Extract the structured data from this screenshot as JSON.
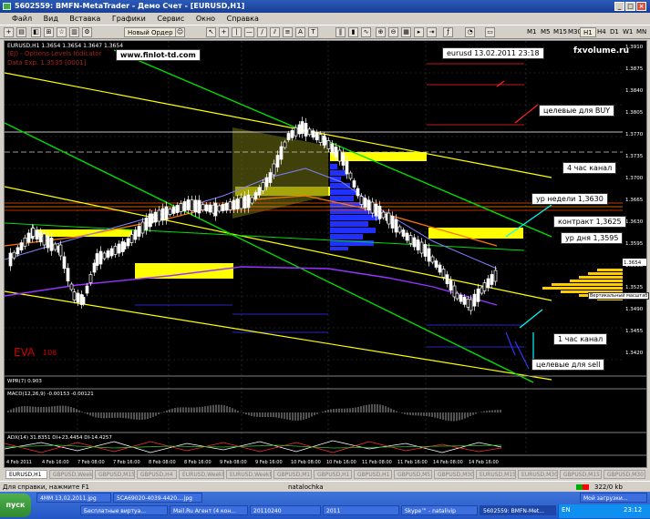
{
  "title": "5602559: BMFN-MetaTrader - Демо Счет - [EURUSD,H1]",
  "menu": [
    "Файл",
    "Вид",
    "Вставка",
    "Графики",
    "Сервис",
    "Окно",
    "Справка"
  ],
  "toolbar": {
    "new_order": "Новый Ордер",
    "timeframes": [
      "M1",
      "M5",
      "M15",
      "M30",
      "H1",
      "H4",
      "D1",
      "W1",
      "MN"
    ]
  },
  "chart": {
    "symbol_info": "EURUSD,H1  1.3654 1.3654 1.3647 1.3654",
    "indicator_line1": "(EJ) - Options Levels Indicator",
    "indicator_line2": "Data Exp. 1.3535 [0001]",
    "ema_label": "EVA",
    "ema_value": "106",
    "macd_label": "MACD(12,26,9) -0.00153 -0.00121",
    "adx_label": "ADX(14) 31.8351 DI+23.4454 DI-14.4257",
    "wpr_label": "WPR(7) 0.903",
    "price_ticks": [
      "1.3910",
      "1.3875",
      "1.3840",
      "1.3805",
      "1.3770",
      "1.3735",
      "1.3700",
      "1.3665",
      "1.3630",
      "1.3595",
      "1.3560",
      "1.3525",
      "1.3490",
      "1.3455",
      "1.3420"
    ],
    "current_price": "1.3654",
    "time_ticks": [
      "4 Feb 2011",
      "4 Feb 16:00",
      "7 Feb 08:00",
      "7 Feb 16:00",
      "8 Feb 08:00",
      "8 Feb 16:00",
      "9 Feb 08:00",
      "9 Feb 16:00",
      "10 Feb 08:00",
      "10 Feb 16:00",
      "11 Feb 08:00",
      "11 Feb 16:00",
      "14 Feb 08:00",
      "14 Feb 16:00"
    ],
    "volume_note": "Вертикальный масштаб"
  },
  "annotations": {
    "site": "www.finlot-td.com",
    "date": "eurusd 13.02.2011 23:18",
    "brand": "fxvolume.ru",
    "targets_buy": "целевые для BUY",
    "channel_4h": "4 час канал",
    "week_level": "ур недели 1,3630",
    "contract": "контракт 1,3625",
    "day_level": "ур дня 1,3595",
    "channel_1h": "1 час канал",
    "targets_sell": "целевые для sell"
  },
  "tabs": [
    "EURUSD,H1",
    "GBPUSD,Weekly",
    "GBPUSD,M15",
    "GBPUSD,H4",
    "EURUSD,Weekly",
    "EURUSD,Weekly",
    "GBPUSD,M1",
    "GBPUSD,H1",
    "GBPUSD,H1",
    "GBPUSD,M5",
    "GBPUSD,M30",
    "EURUSD,M15",
    "EURUSD,M30",
    "GBPUSD,M15",
    "GBPUSD,M30"
  ],
  "status": {
    "help": "Для справки, нажмите F1",
    "profile": "natalochka",
    "traffic": "322/0 kb"
  },
  "taskbar": {
    "start": "пуск",
    "items": [
      "4MM 13,02,2011.jpg",
      "5CA69020-4039-4420....jpg",
      "Бесплатные виртуа...",
      "Mail.Ru Агент (4 кон...",
      "20110240",
      "2011",
      "Skype™ - natalivip",
      "5602559: BMFN-Met...",
      "Мой загрузки..."
    ],
    "lang": "EN",
    "clock": "23:12"
  },
  "colors": {
    "chart_bg": "#000000",
    "candles": "#00ff00",
    "grid": "#2a2a2a",
    "yellow_zone": "#ffff00",
    "volume": "#3030ff"
  }
}
